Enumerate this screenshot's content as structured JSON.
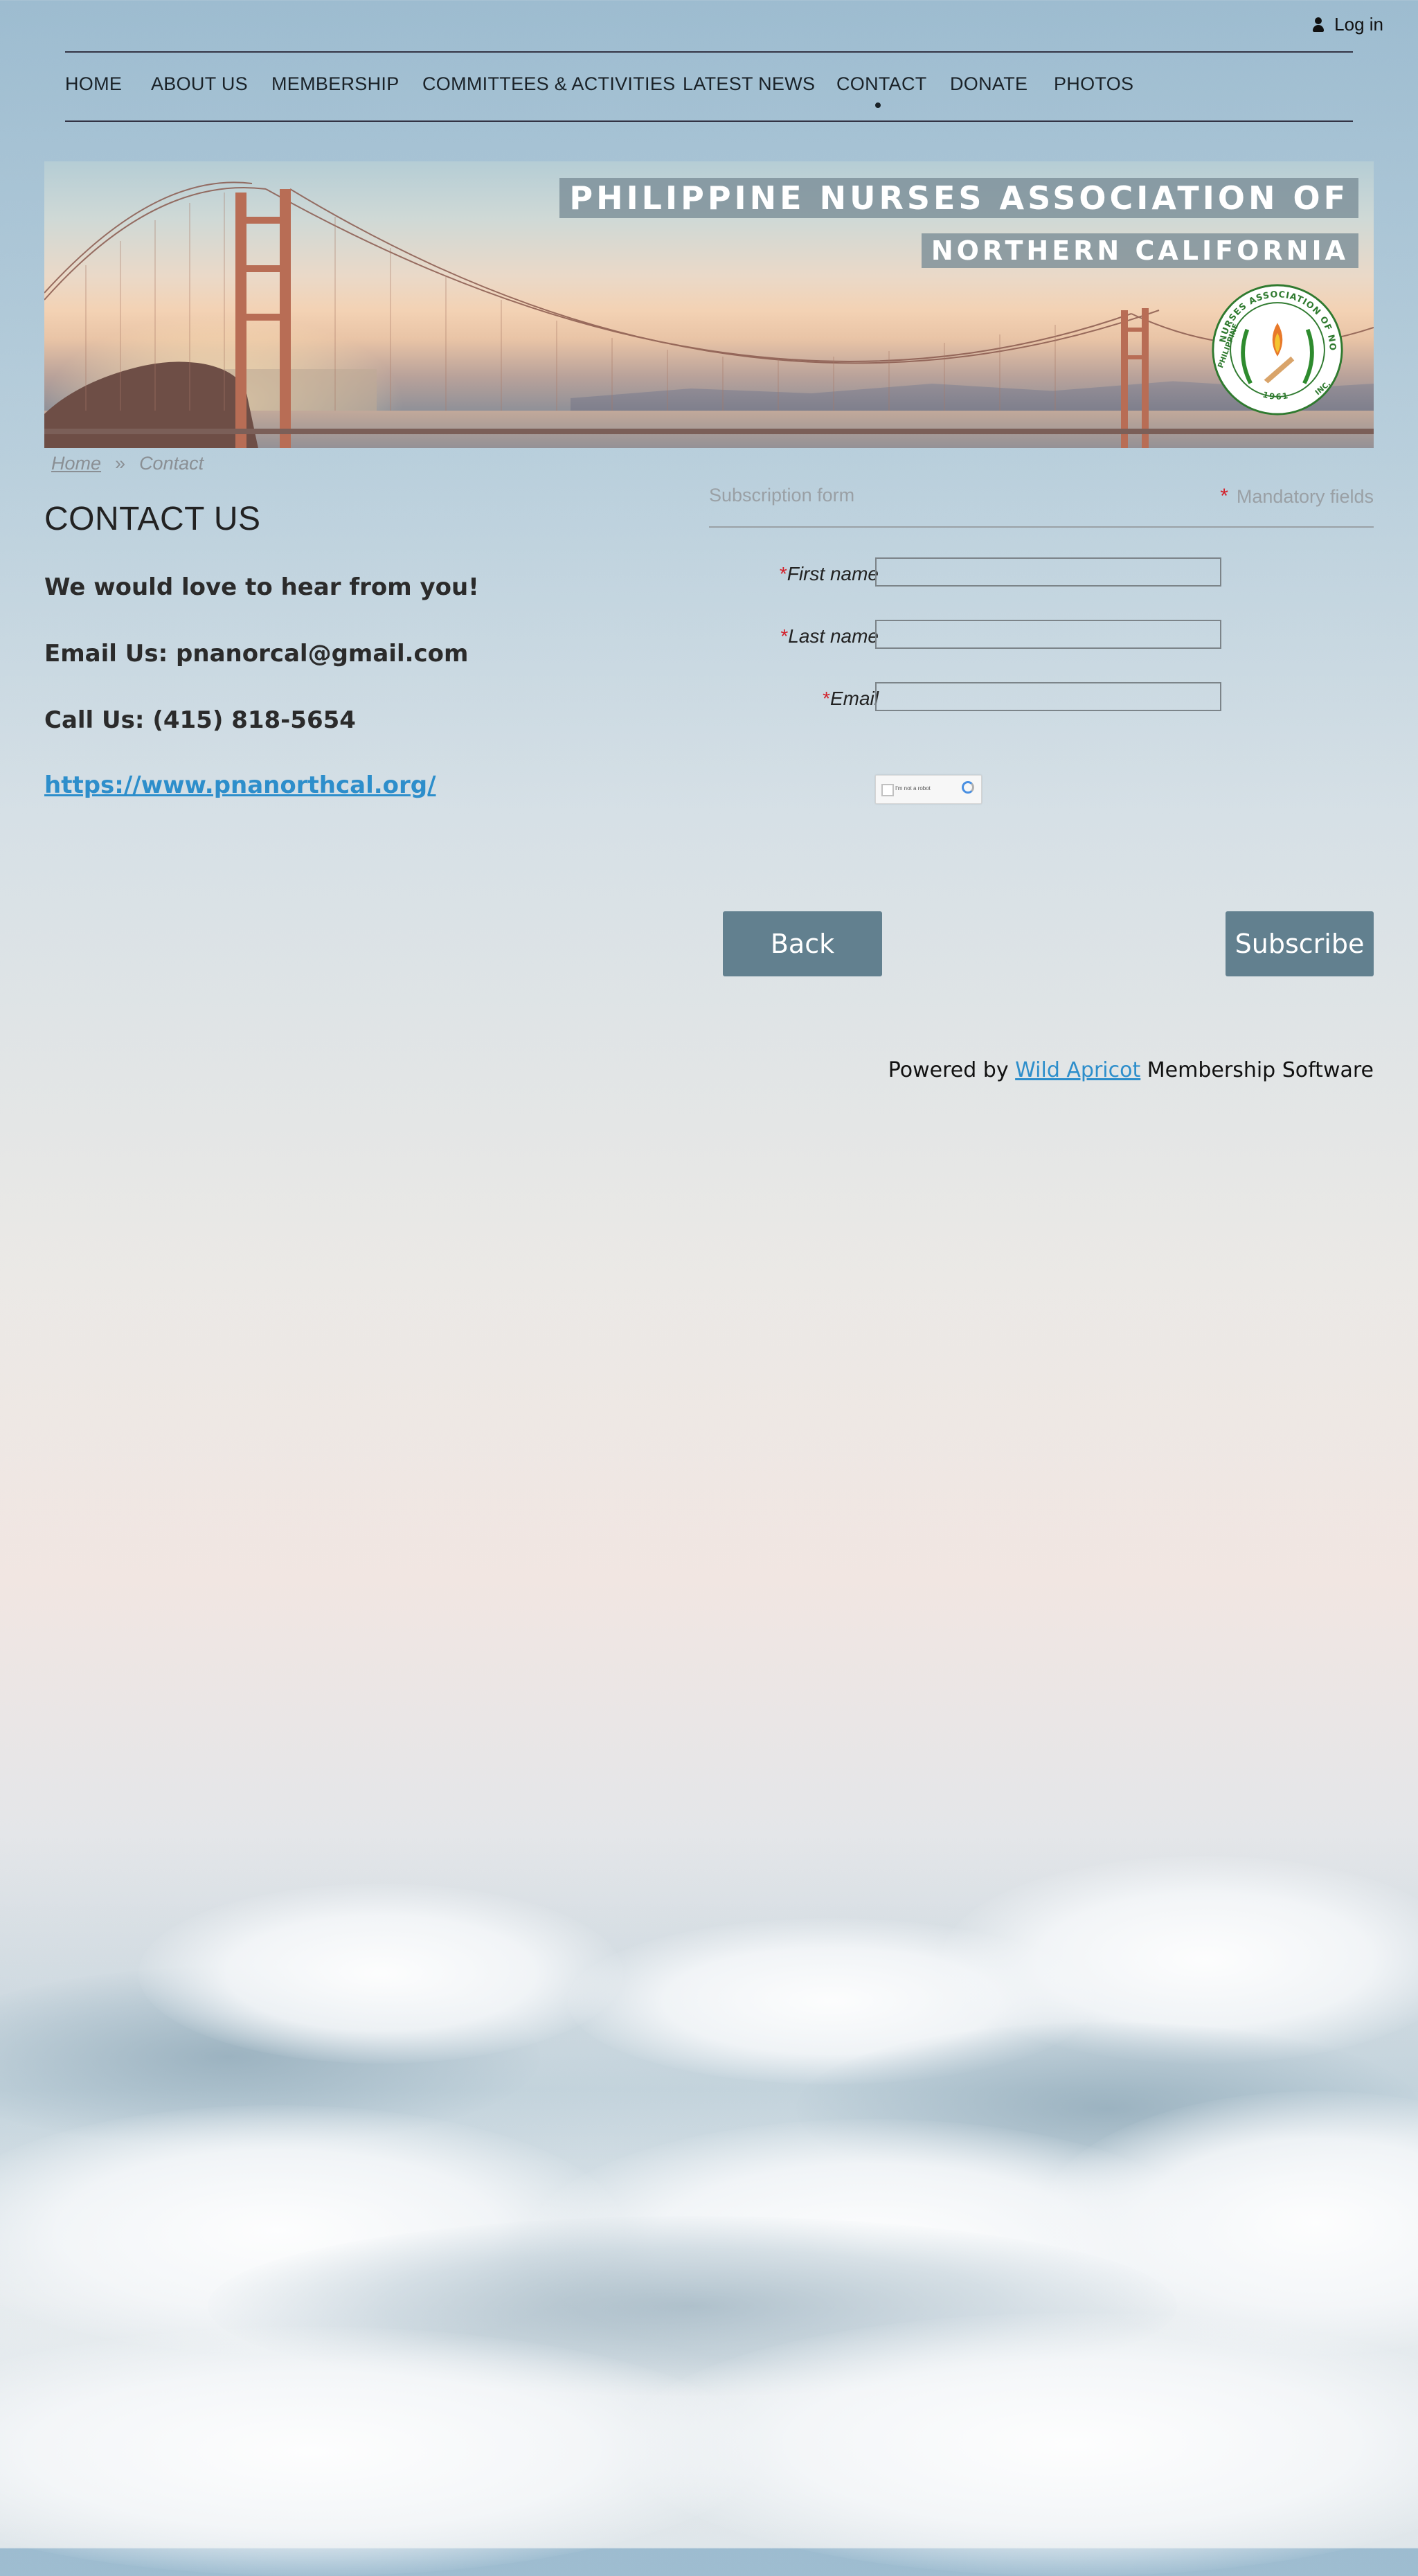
{
  "header": {
    "login_label": "Log in",
    "login_icon": "person-icon"
  },
  "nav": {
    "items": [
      "HOME",
      "ABOUT US",
      "MEMBERSHIP",
      "COMMITTEES & ACTIVITIES",
      "LATEST NEWS",
      "CONTACT",
      "DONATE",
      "PHOTOS"
    ],
    "active": "CONTACT"
  },
  "banner": {
    "title_line1": "PHILIPPINE NURSES ASSOCIATION OF",
    "title_line2": "NORTHERN CALIFORNIA",
    "seal_text_top": "NURSES ASSOCIATION OF NORTHERN CALIFORNIA",
    "seal_text_left": "PHILIPPINE",
    "seal_text_bottom": "1961",
    "seal_text_right": "INC."
  },
  "breadcrumb": {
    "home": "Home",
    "separator": "»",
    "current": "Contact"
  },
  "content": {
    "heading": "CONTACT US",
    "line1": "We would love to hear from you!",
    "line2": "Email Us: pnanorcal@gmail.com",
    "line3": "Call Us: (415) 818-5654",
    "link": "https://www.pnanorthcal.org/"
  },
  "form": {
    "title": "Subscription form",
    "mandatory_star": "*",
    "mandatory_label": "Mandatory fields",
    "fields": [
      {
        "label": "First name",
        "required": "*",
        "value": ""
      },
      {
        "label": "Last name",
        "required": "*",
        "value": ""
      },
      {
        "label": "Email",
        "required": "*",
        "value": ""
      }
    ],
    "captcha_label": "I'm not a robot",
    "back_label": "Back",
    "subscribe_label": "Subscribe"
  },
  "footer": {
    "powered_prefix": "Powered by",
    "powered_link": "Wild Apricot",
    "powered_suffix": "Membership Software"
  },
  "colors": {
    "button": "#62808f",
    "link": "#2d8ecb",
    "required": "#d3202a",
    "banner_label_bg": "#788c96"
  }
}
